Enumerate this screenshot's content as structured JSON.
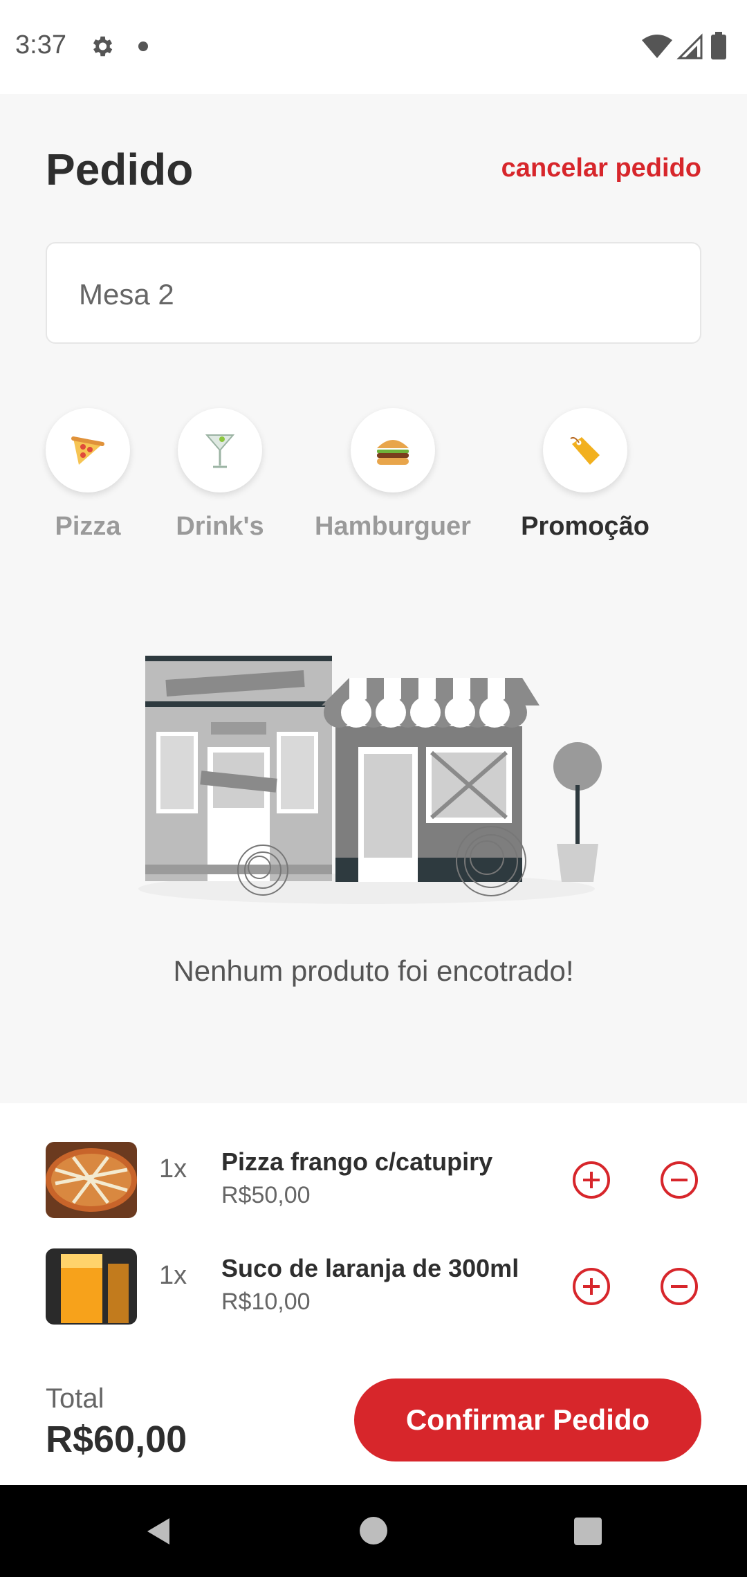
{
  "status": {
    "time": "3:37"
  },
  "header": {
    "title": "Pedido",
    "cancel_label": "cancelar pedido"
  },
  "table_field": {
    "value": "Mesa 2"
  },
  "categories": [
    {
      "label": "Pizza",
      "icon": "pizza-icon",
      "active": false
    },
    {
      "label": "Drink's",
      "icon": "cocktail-icon",
      "active": false
    },
    {
      "label": "Hamburguer",
      "icon": "burger-icon",
      "active": false
    },
    {
      "label": "Promoção",
      "icon": "tag-icon",
      "active": true
    }
  ],
  "empty_state": {
    "message": "Nenhum produto foi encotrado!"
  },
  "cart": {
    "items": [
      {
        "qty": "1x",
        "name": "Pizza frango c/catupiry",
        "price": "R$50,00"
      },
      {
        "qty": "1x",
        "name": "Suco de laranja de 300ml",
        "price": "R$10,00"
      }
    ],
    "total_label": "Total",
    "total_value": "R$60,00",
    "confirm_label": "Confirmar Pedido"
  },
  "colors": {
    "accent": "#d7262b",
    "text_dark": "#2e2e2e",
    "text_muted": "#9a9a9a"
  }
}
